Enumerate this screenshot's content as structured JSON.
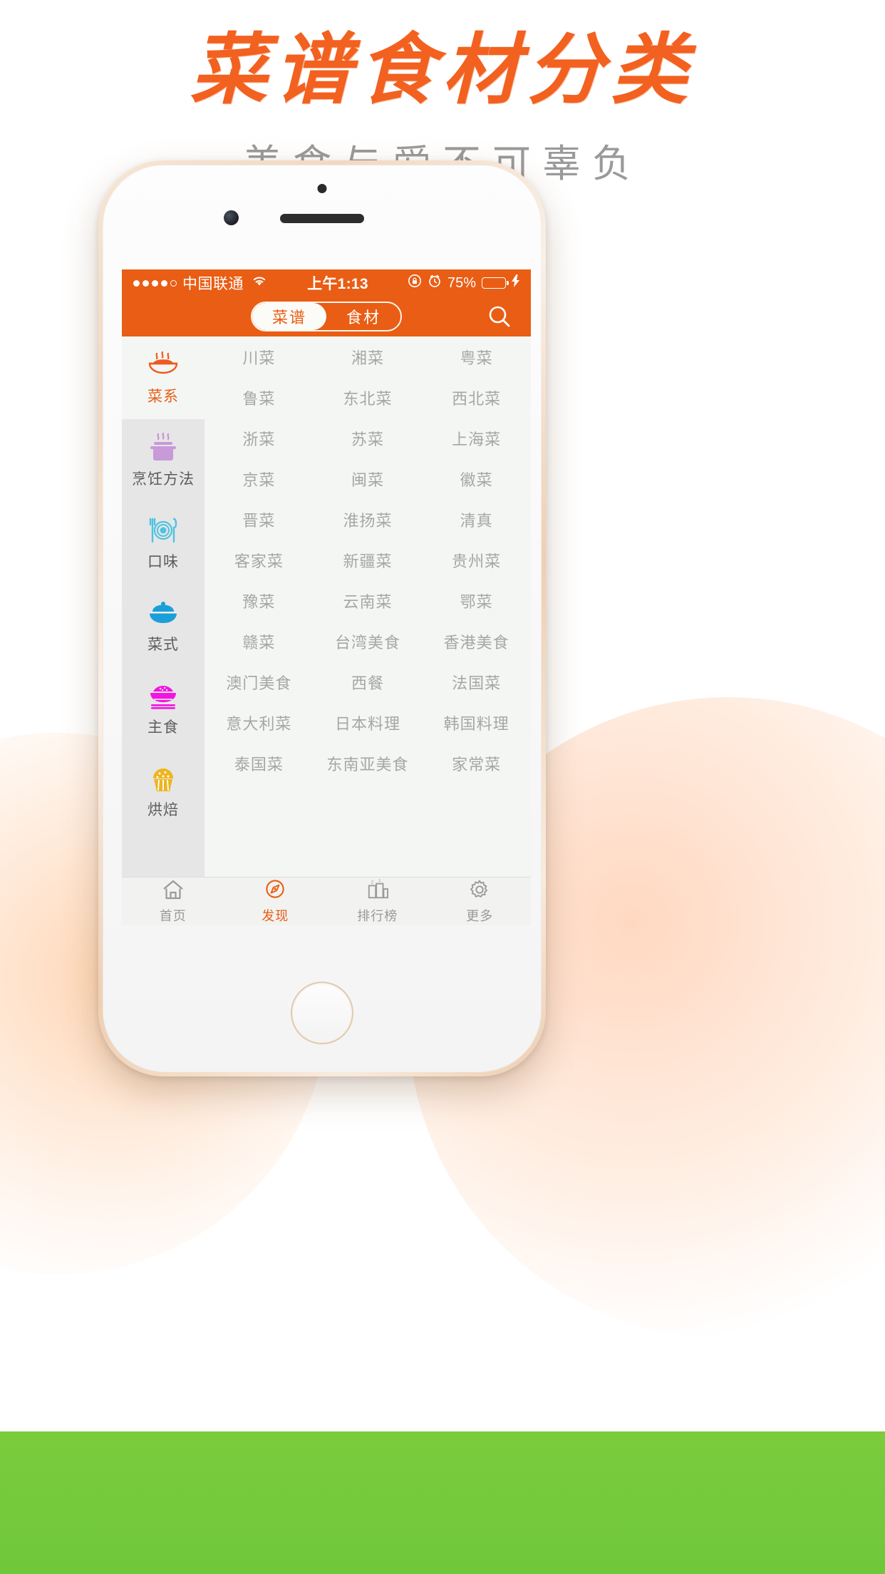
{
  "promo": {
    "title": "菜谱食材分类",
    "subtitle": "美食与爱不可辜负",
    "title_color": "#f2611f",
    "subtitle_color": "#9a9a9a"
  },
  "statusbar": {
    "carrier": "中国联通",
    "signal_dots_filled": 4,
    "signal_dots_total": 5,
    "wifi_icon": "wifi-icon",
    "time": "上午1:13",
    "rotation_lock_icon": "rotation-lock-icon",
    "alarm_icon": "alarm-clock-icon",
    "battery_percent": "75%",
    "battery_level": 75,
    "battery_fill_color": "#4cd34c",
    "charging_icon": "lightning-bolt-icon",
    "background_color": "#e95d14"
  },
  "navbar": {
    "segments": [
      {
        "label": "菜谱",
        "active": true
      },
      {
        "label": "食材",
        "active": false
      }
    ],
    "search_icon": "search-icon",
    "background_color": "#e95d14",
    "active_text_color": "#e95d14"
  },
  "sidebar": {
    "items": [
      {
        "label": "菜系",
        "icon": "steaming-bowl-icon",
        "color": "#ef5a1e",
        "active": true
      },
      {
        "label": "烹饪方法",
        "icon": "steaming-pot-icon",
        "color": "#c89ad8",
        "active": false
      },
      {
        "label": "口味",
        "icon": "cutlery-plate-icon",
        "color": "#4ec3e0",
        "active": false
      },
      {
        "label": "菜式",
        "icon": "covered-pot-icon",
        "color": "#1b9fd8",
        "active": false
      },
      {
        "label": "主食",
        "icon": "rice-bowl-icon",
        "color": "#f215e0",
        "active": false
      },
      {
        "label": "烘焙",
        "icon": "cupcake-icon",
        "color": "#edb51f",
        "active": false
      }
    ]
  },
  "grid": {
    "items": [
      "川菜",
      "湘菜",
      "粤菜",
      "鲁菜",
      "东北菜",
      "西北菜",
      "浙菜",
      "苏菜",
      "上海菜",
      "京菜",
      "闽菜",
      "徽菜",
      "晋菜",
      "淮扬菜",
      "清真",
      "客家菜",
      "新疆菜",
      "贵州菜",
      "豫菜",
      "云南菜",
      "鄂菜",
      "赣菜",
      "台湾美食",
      "香港美食",
      "澳门美食",
      "西餐",
      "法国菜",
      "意大利菜",
      "日本料理",
      "韩国料理",
      "泰国菜",
      "东南亚美食",
      "家常菜"
    ]
  },
  "tabbar": {
    "items": [
      {
        "label": "首页",
        "icon": "home-icon",
        "active": false
      },
      {
        "label": "发现",
        "icon": "compass-icon",
        "active": true
      },
      {
        "label": "排行榜",
        "icon": "bar-chart-icon",
        "active": false
      },
      {
        "label": "更多",
        "icon": "gear-icon",
        "active": false
      }
    ],
    "active_color": "#e95d14",
    "inactive_color": "#9a9a9a"
  }
}
